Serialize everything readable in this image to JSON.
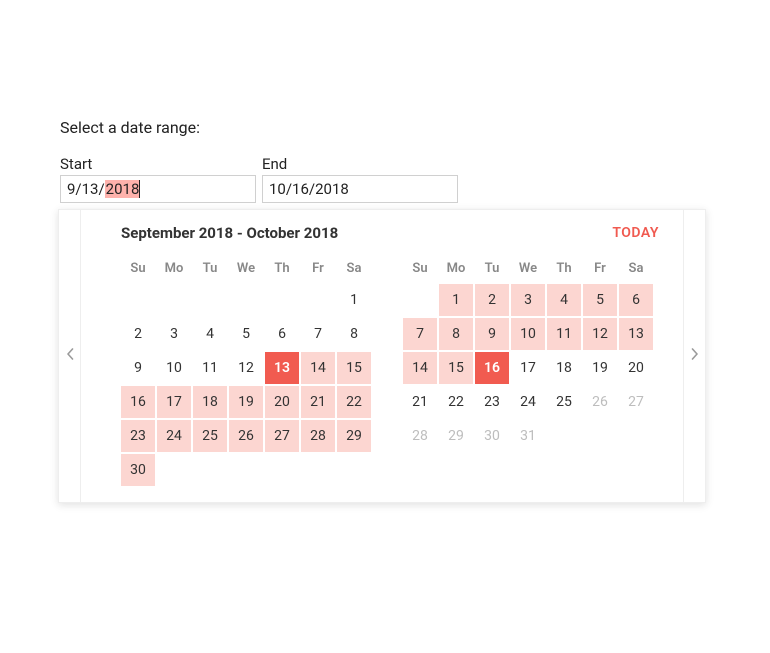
{
  "prompt": "Select a date range:",
  "fields": {
    "start": {
      "label": "Start",
      "value_prefix": "9/13/",
      "value_selected": "2018"
    },
    "end": {
      "label": "End",
      "value": "10/16/2018"
    }
  },
  "calendar": {
    "title": "September 2018 - October 2018",
    "today_label": "TODAY",
    "dow": [
      "Su",
      "Mo",
      "Tu",
      "We",
      "Th",
      "Fr",
      "Sa"
    ],
    "months": [
      {
        "name": "September 2018",
        "leading_blanks": 6,
        "days": [
          {
            "n": 1
          },
          {
            "n": 2
          },
          {
            "n": 3
          },
          {
            "n": 4
          },
          {
            "n": 5
          },
          {
            "n": 6
          },
          {
            "n": 7
          },
          {
            "n": 8
          },
          {
            "n": 9
          },
          {
            "n": 10
          },
          {
            "n": 11
          },
          {
            "n": 12
          },
          {
            "n": 13,
            "state": "selected"
          },
          {
            "n": 14,
            "state": "in-range"
          },
          {
            "n": 15,
            "state": "in-range"
          },
          {
            "n": 16,
            "state": "in-range"
          },
          {
            "n": 17,
            "state": "in-range"
          },
          {
            "n": 18,
            "state": "in-range"
          },
          {
            "n": 19,
            "state": "in-range"
          },
          {
            "n": 20,
            "state": "in-range"
          },
          {
            "n": 21,
            "state": "in-range"
          },
          {
            "n": 22,
            "state": "in-range"
          },
          {
            "n": 23,
            "state": "in-range"
          },
          {
            "n": 24,
            "state": "in-range"
          },
          {
            "n": 25,
            "state": "in-range"
          },
          {
            "n": 26,
            "state": "in-range"
          },
          {
            "n": 27,
            "state": "in-range"
          },
          {
            "n": 28,
            "state": "in-range"
          },
          {
            "n": 29,
            "state": "in-range"
          },
          {
            "n": 30,
            "state": "in-range"
          }
        ]
      },
      {
        "name": "October 2018",
        "leading_blanks": 1,
        "days": [
          {
            "n": 1,
            "state": "in-range"
          },
          {
            "n": 2,
            "state": "in-range"
          },
          {
            "n": 3,
            "state": "in-range"
          },
          {
            "n": 4,
            "state": "in-range"
          },
          {
            "n": 5,
            "state": "in-range"
          },
          {
            "n": 6,
            "state": "in-range"
          },
          {
            "n": 7,
            "state": "in-range"
          },
          {
            "n": 8,
            "state": "in-range"
          },
          {
            "n": 9,
            "state": "in-range"
          },
          {
            "n": 10,
            "state": "in-range"
          },
          {
            "n": 11,
            "state": "in-range"
          },
          {
            "n": 12,
            "state": "in-range"
          },
          {
            "n": 13,
            "state": "in-range"
          },
          {
            "n": 14,
            "state": "in-range"
          },
          {
            "n": 15,
            "state": "in-range"
          },
          {
            "n": 16,
            "state": "selected"
          },
          {
            "n": 17
          },
          {
            "n": 18
          },
          {
            "n": 19
          },
          {
            "n": 20
          },
          {
            "n": 21
          },
          {
            "n": 22
          },
          {
            "n": 23
          },
          {
            "n": 24
          },
          {
            "n": 25
          },
          {
            "n": 26,
            "state": "outside"
          },
          {
            "n": 27,
            "state": "outside"
          },
          {
            "n": 28,
            "state": "outside"
          },
          {
            "n": 29,
            "state": "outside"
          },
          {
            "n": 30,
            "state": "outside"
          },
          {
            "n": 31,
            "state": "outside"
          }
        ]
      }
    ]
  }
}
